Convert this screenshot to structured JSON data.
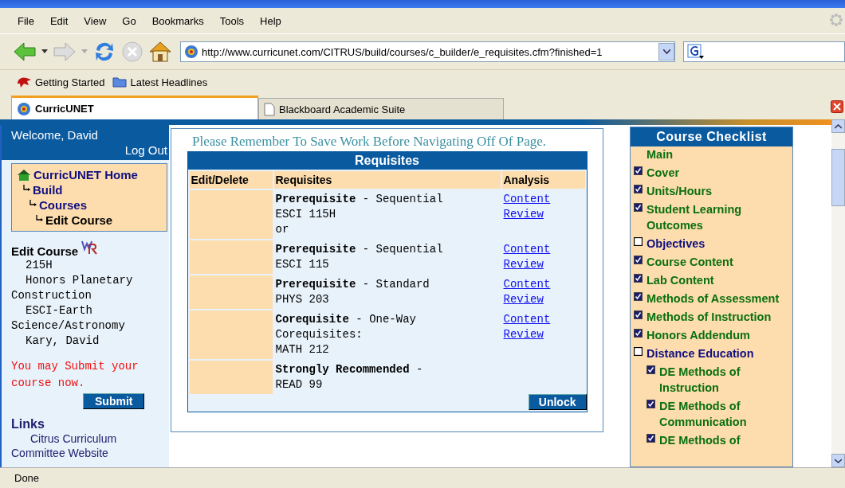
{
  "menu": [
    "File",
    "Edit",
    "View",
    "Go",
    "Bookmarks",
    "Tools",
    "Help"
  ],
  "address": {
    "value": "http://www.curricunet.com/CITRUS/build/courses/c_builder/e_requisites.cfm?finished=1"
  },
  "bookmarks": [
    "Getting Started",
    "Latest Headlines"
  ],
  "tabs": [
    {
      "label": "CurricUNET",
      "selected": true
    },
    {
      "label": "Blackboard Academic Suite",
      "selected": false
    }
  ],
  "sidebar": {
    "welcome": "Welcome, David",
    "logout": "Log Out",
    "breadcrumb": [
      {
        "label": "CurricUNET Home",
        "current": false,
        "children": [
          {
            "label": "Build",
            "current": false,
            "children": [
              {
                "label": "Courses",
                "current": false,
                "children": [
                  {
                    "label": "Edit Course",
                    "current": true
                  }
                ]
              }
            ]
          }
        ]
      }
    ],
    "course_heading": "Edit Course",
    "course_info": [
      "215H",
      "Honors Planetary Construction",
      "ESCI-Earth Science/Astronomy",
      "Kary, David"
    ],
    "submit_message": "You may Submit your course now.",
    "submit_button": "Submit",
    "links_heading": "Links",
    "links": [
      "Citrus Curriculum Committee Website"
    ]
  },
  "notice": "Please Remember To Save Work Before Navigating Off Of Page.",
  "requisites": {
    "title": "Requisites",
    "columns": [
      "Edit/Delete",
      "Requisites",
      "Analysis"
    ],
    "rows": [
      {
        "heading": "**Prerequisite** - Sequential",
        "lines": [
          "ESCI 115H",
          "or"
        ],
        "link": "Content Review"
      },
      {
        "heading": "**Prerequisite** - Sequential",
        "lines": [
          "ESCI 115"
        ],
        "link": "Content Review"
      },
      {
        "heading": "**Prerequisite** - Standard",
        "lines": [
          "PHYS 203"
        ],
        "link": "Content Review"
      },
      {
        "heading": "**Corequisite** - One-Way",
        "lines": [
          "Corequisites:",
          "MATH 212"
        ],
        "link": "Content Review"
      },
      {
        "heading": "**Strongly Recommended** -",
        "lines": [
          "READ 99"
        ]
      }
    ],
    "button": "Unlock"
  },
  "checklist": {
    "title": "Course Checklist",
    "items": [
      {
        "label": "Main",
        "kind": "plain"
      },
      {
        "label": "Cover",
        "kind": "check",
        "checked": true
      },
      {
        "label": "Units/Hours",
        "kind": "check",
        "checked": true
      },
      {
        "label": "Student Learning Outcomes",
        "kind": "check",
        "checked": true
      },
      {
        "label": "Objectives",
        "kind": "check",
        "checked": false
      },
      {
        "label": "Course Content",
        "kind": "check",
        "checked": true
      },
      {
        "label": "Lab Content",
        "kind": "check",
        "checked": true
      },
      {
        "label": "Methods of Assessment",
        "kind": "check",
        "checked": true
      },
      {
        "label": "Methods of Instruction",
        "kind": "check",
        "checked": true
      },
      {
        "label": "Honors Addendum",
        "kind": "check",
        "checked": true
      },
      {
        "label": "Distance Education",
        "kind": "check",
        "checked": false,
        "children": [
          {
            "label": "DE Methods of Instruction",
            "kind": "check",
            "checked": true
          },
          {
            "label": "DE Methods of Communication",
            "kind": "check",
            "checked": true
          },
          {
            "label": "DE Methods of",
            "kind": "check",
            "checked": true
          }
        ]
      }
    ]
  },
  "status_bar": "Done"
}
